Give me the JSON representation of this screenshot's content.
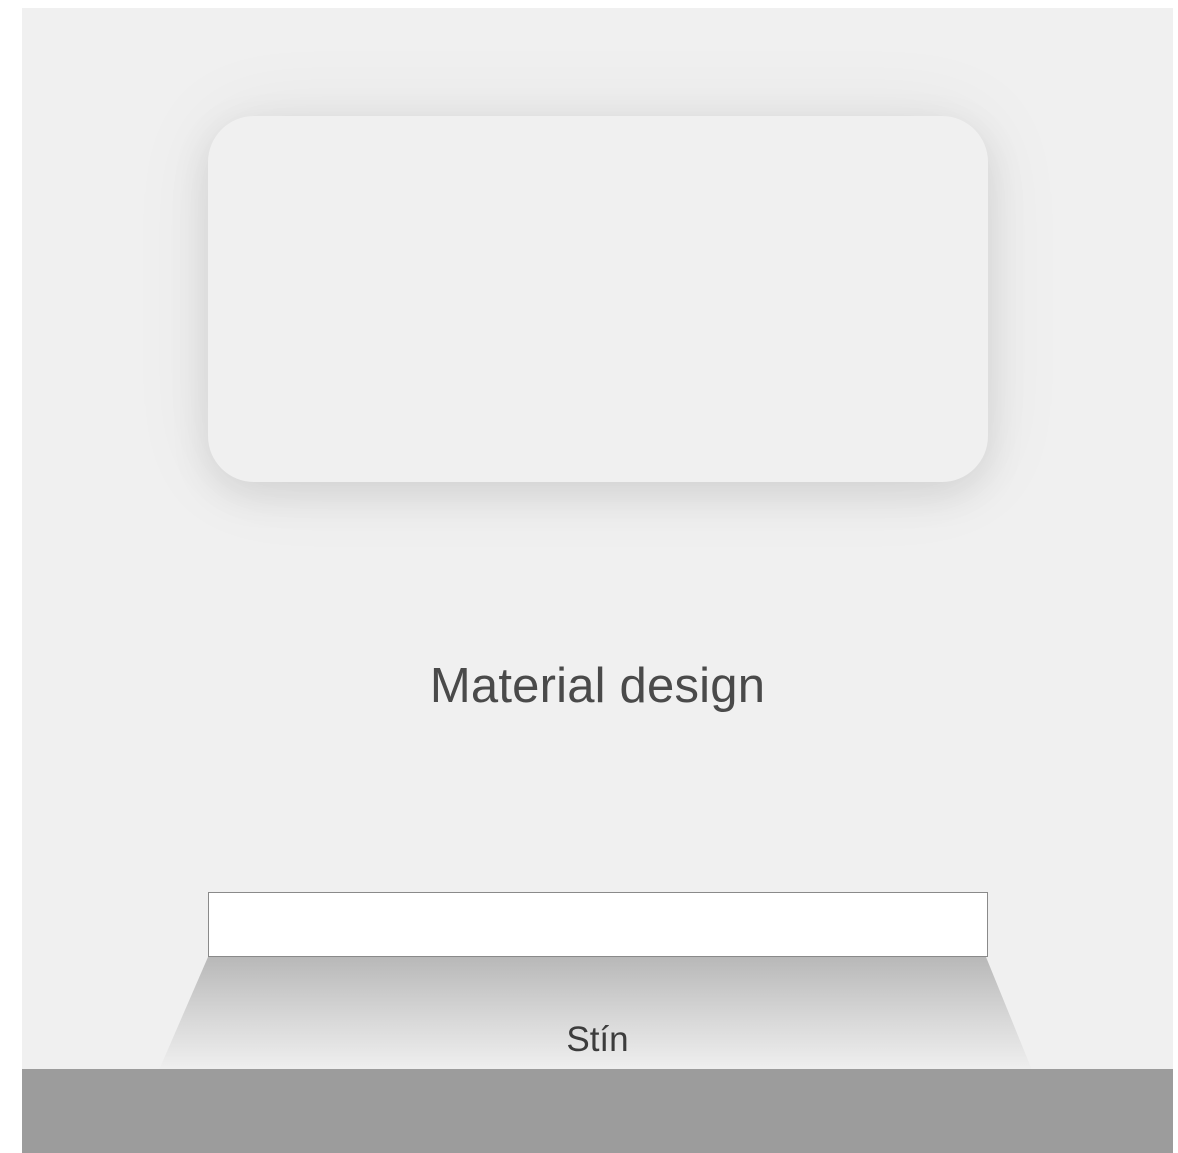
{
  "title": "Material design",
  "shadow_label": "Stín",
  "colors": {
    "background": "#f0f0f0",
    "floor": "#9c9c9c",
    "slab": "#ffffff",
    "text": "#4a4a4a"
  }
}
